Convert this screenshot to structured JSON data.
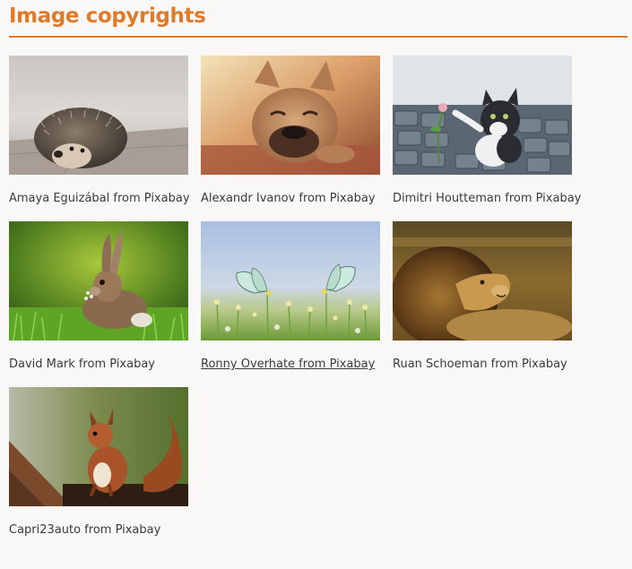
{
  "page": {
    "title": "Image copyrights",
    "accent_color": "#dd7a2c"
  },
  "gallery": {
    "items": [
      {
        "subject": "hedgehog",
        "credit": "Amaya Eguizábal from Pixabay",
        "hovered": false
      },
      {
        "subject": "french-bulldog",
        "credit": "Alexandr Ivanov from Pixabay",
        "hovered": false
      },
      {
        "subject": "kitten-with-flower",
        "credit": "Dimitri Houtteman from Pixabay",
        "hovered": false
      },
      {
        "subject": "rabbit",
        "credit": "David Mark from Pixabay",
        "hovered": false
      },
      {
        "subject": "butterflies",
        "credit": "Ronny Overhate from Pixabay",
        "hovered": true
      },
      {
        "subject": "lion",
        "credit": "Ruan Schoeman from Pixabay",
        "hovered": false
      },
      {
        "subject": "red-squirrel",
        "credit": "Capri23auto from Pixabay",
        "hovered": false
      }
    ]
  }
}
